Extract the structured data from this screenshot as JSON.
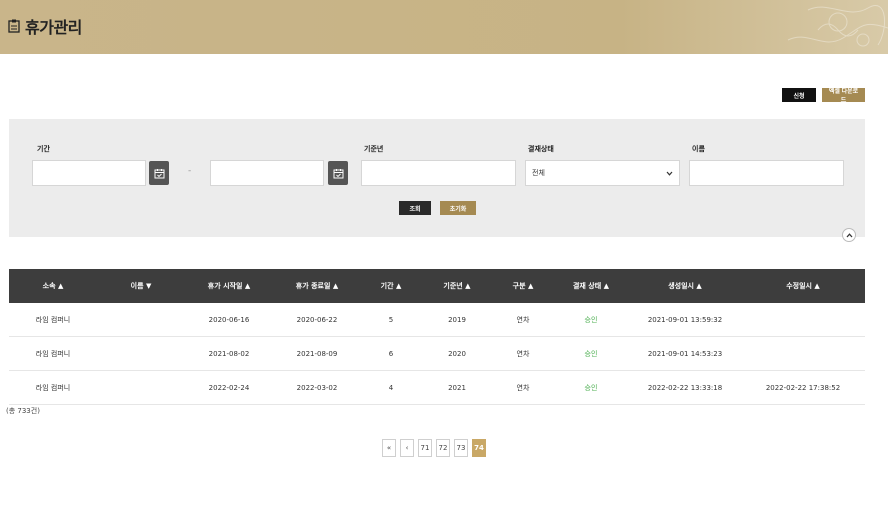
{
  "header": {
    "title": "휴가관리"
  },
  "actions": {
    "apply_label": "신청",
    "excel_label": "엑셀 다운로드"
  },
  "filters": {
    "period_label": "기간",
    "period_separator": "-",
    "base_year_label": "기준년",
    "approval_status_label": "결재상태",
    "approval_status_value": "전체",
    "name_label": "이름",
    "search_label": "조회",
    "reset_label": "초기화"
  },
  "table": {
    "headers": [
      "소속 ▲",
      "이름 ▼",
      "휴가 시작일 ▲",
      "휴가 종료일 ▲",
      "기간 ▲",
      "기준년 ▲",
      "구분 ▲",
      "결재 상태 ▲",
      "생성일시 ▲",
      "수정일시 ▲"
    ],
    "rows": [
      [
        "라임 컴퍼니",
        "",
        "2020-06-16",
        "2020-06-22",
        "5",
        "2019",
        "연차",
        "승인",
        "2021-09-01 13:59:32",
        ""
      ],
      [
        "라임 컴퍼니",
        "",
        "2021-08-02",
        "2021-08-09",
        "6",
        "2020",
        "연차",
        "승인",
        "2021-09-01 14:53:23",
        ""
      ],
      [
        "라임 컴퍼니",
        "",
        "2022-02-24",
        "2022-03-02",
        "4",
        "2021",
        "연차",
        "승인",
        "2022-02-22 13:33:18",
        "2022-02-22 17:38:52"
      ]
    ],
    "total_text": "(총 733건)"
  },
  "pagination": {
    "first_label": "«",
    "prev_label": "‹",
    "pages": [
      "71",
      "72",
      "73",
      "74"
    ],
    "active_page": "74"
  },
  "colors": {
    "accent": "#a58a52",
    "header_bg": "#c9b58a",
    "approved": "#4caf50",
    "table_head": "#3d3d3d"
  }
}
